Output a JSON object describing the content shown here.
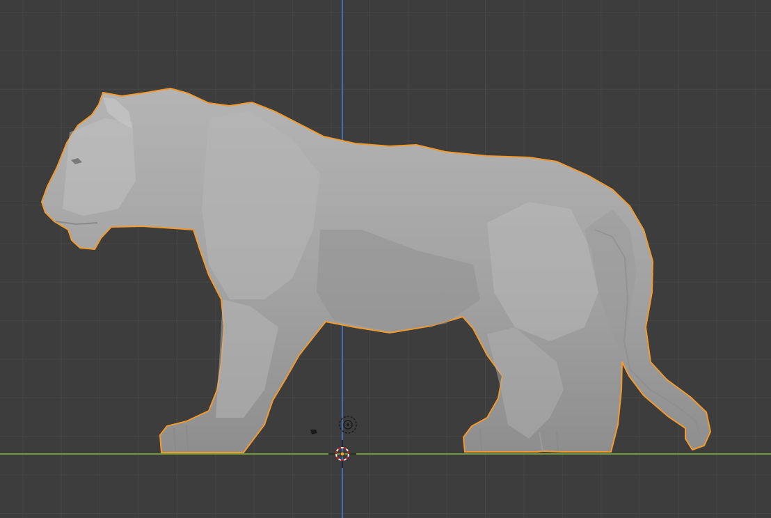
{
  "viewport": {
    "view": "right-orthographic",
    "grid": true,
    "background_color": "#3d3d3d",
    "grid_color": "#464646"
  },
  "axes": {
    "vertical_axis_color": "#3d6fbd",
    "horizontal_axis_color": "#6e9a3a"
  },
  "object": {
    "kind": "lioness-sculpt",
    "selected": true,
    "selection_outline_color": "#f29a2e",
    "surface_color": "#a8a8a8"
  },
  "icons": {
    "camera": "camera-icon",
    "light": "light-icon",
    "origin": "object-origin-icon",
    "cursor": "3d-cursor-icon"
  }
}
